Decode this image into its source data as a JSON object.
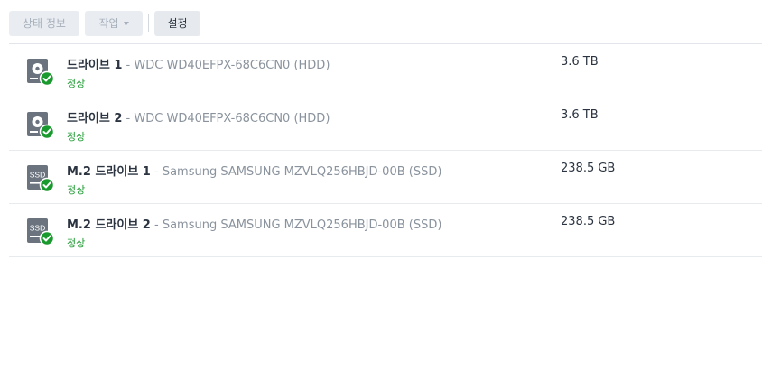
{
  "toolbar": {
    "status_info_label": "상태 정보",
    "action_label": "작업",
    "settings_label": "설정"
  },
  "disks": [
    {
      "name": "드라이브 1",
      "separator": " - ",
      "model": "WDC WD40EFPX-68C6CN0 (HDD)",
      "status": "정상",
      "capacity": "3.6 TB",
      "icon": "hdd-icon",
      "type": "hdd"
    },
    {
      "name": "드라이브 2",
      "separator": " - ",
      "model": "WDC WD40EFPX-68C6CN0 (HDD)",
      "status": "정상",
      "capacity": "3.6 TB",
      "icon": "hdd-icon",
      "type": "hdd"
    },
    {
      "name": "M.2 드라이브 1",
      "separator": " - ",
      "model": "Samsung SAMSUNG MZVLQ256HBJD-00B (SSD)",
      "status": "정상",
      "capacity": "238.5 GB",
      "icon": "ssd-icon",
      "type": "ssd",
      "icon_text": "SSD"
    },
    {
      "name": "M.2 드라이브 2",
      "separator": " - ",
      "model": "Samsung SAMSUNG MZVLQ256HBJD-00B (SSD)",
      "status": "정상",
      "capacity": "238.5 GB",
      "icon": "ssd-icon",
      "type": "ssd",
      "icon_text": "SSD"
    }
  ],
  "colors": {
    "status_ok": "#1a9a2e",
    "icon_gray": "#6b747e"
  }
}
